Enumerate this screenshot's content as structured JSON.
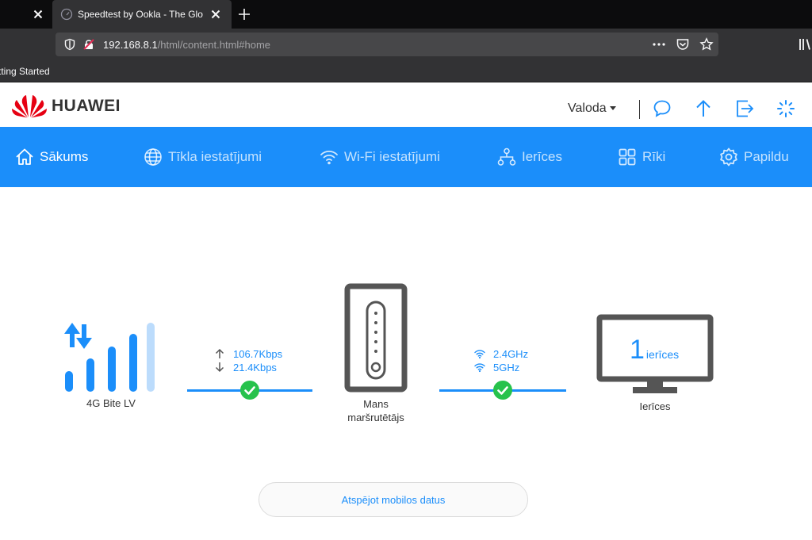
{
  "browser": {
    "tabs": [
      {
        "title": "Speedtest by Ookla - The Global Broadband Speed Test"
      }
    ],
    "url": {
      "host": "192.168.8.1",
      "path": "/html/content.html#home"
    },
    "bookmarks": [
      {
        "label": "Getting Started"
      }
    ]
  },
  "header": {
    "brand": "HUAWEI",
    "language_label": "Valoda",
    "icons": [
      "message-icon",
      "upload-icon",
      "logout-icon",
      "loading-icon"
    ]
  },
  "nav": {
    "items": [
      {
        "label": "Sākums",
        "icon": "home-icon"
      },
      {
        "label": "Tīkla iestatījumi",
        "icon": "globe-icon"
      },
      {
        "label": "Wi-Fi iestatījumi",
        "icon": "wifi-icon"
      },
      {
        "label": "Ierīces",
        "icon": "topology-icon"
      },
      {
        "label": "Rīki",
        "icon": "tools-icon"
      },
      {
        "label": "Papildu",
        "icon": "gear-icon"
      }
    ]
  },
  "topology": {
    "network": {
      "label": "4G Bite LV",
      "signal_bars_active": 4,
      "signal_bars_total": 5
    },
    "wan": {
      "upload": "106.7Kbps",
      "download": "21.4Kbps",
      "status": "ok"
    },
    "router": {
      "label_line1": "Mans",
      "label_line2": "maršrutētājs"
    },
    "wifi": {
      "band1": "2.4GHz",
      "band2": "5GHz",
      "status": "ok"
    },
    "devices": {
      "count": "1",
      "unit": "ierīces",
      "label": "Ierīces"
    }
  },
  "actions": {
    "disable_mobile_data": "Atspējot mobilos datus"
  },
  "colors": {
    "accent": "#1b8efa",
    "success": "#27c24c",
    "chrome_dark": "#0c0c0d",
    "chrome": "#323234",
    "brand_red": "#e60012"
  }
}
